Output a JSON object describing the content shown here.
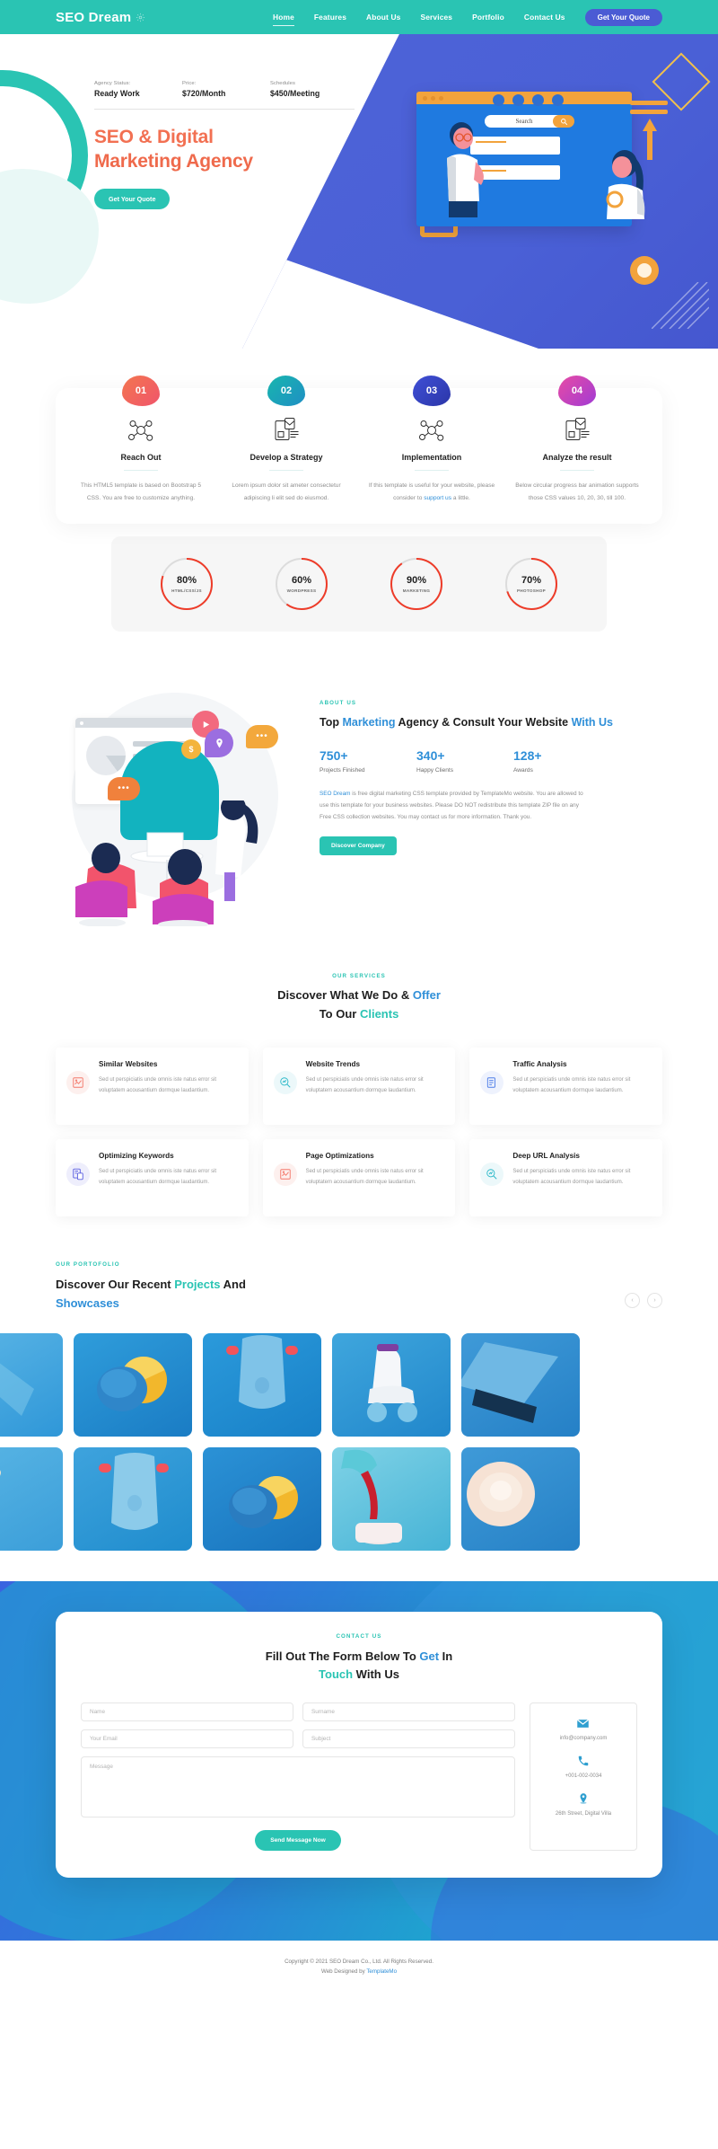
{
  "nav": {
    "brand": "SEO Dream",
    "brand_icon": "gear-settings-icon",
    "links": [
      {
        "label": "Home",
        "active": true
      },
      {
        "label": "Features",
        "active": false
      },
      {
        "label": "About Us",
        "active": false
      },
      {
        "label": "Services",
        "active": false
      },
      {
        "label": "Portfolio",
        "active": false
      },
      {
        "label": "Contact Us",
        "active": false
      }
    ],
    "cta": "Get Your Quote",
    "bg_color": "#2ac4b3",
    "cta_color": "#4b5bd4"
  },
  "hero": {
    "stats": [
      {
        "label": "Agency Status:",
        "value": "Ready Work"
      },
      {
        "label": "Price:",
        "value": "$720/Month"
      },
      {
        "label": "Schedules",
        "value": "$450/Meeting"
      }
    ],
    "title_line1": "SEO & Digital",
    "title_line2": "Marketing Agency",
    "cta": "Get Your Quote",
    "title_color": "#f27052",
    "illustration": {
      "search_placeholder": "Search",
      "name": "seo-team-illustration"
    }
  },
  "process": {
    "items": [
      {
        "number": "01",
        "title": "Reach Out",
        "text": "This HTML5 template is based on Bootstrap 5 CSS. You are free to customize anything.",
        "link_text": "",
        "link_suffix": "",
        "color_a": "#f3764f",
        "color_b": "#f0556b",
        "icon": "network-share-icon"
      },
      {
        "number": "02",
        "title": "Develop a Strategy",
        "text": "Lorem ipsum dolor sit ameter consectetur adipiscing li elit sed do eiusmod.",
        "link_text": "",
        "link_suffix": "",
        "color_a": "#18b6ae",
        "color_b": "#1f8fc4",
        "icon": "document-layout-icon"
      },
      {
        "number": "03",
        "title": "Implementation",
        "text": "If this template is useful for your website, please consider to ",
        "link_text": "support us",
        "link_suffix": " a little.",
        "color_a": "#3f4fd6",
        "color_b": "#2b36a8",
        "icon": "network-share-icon"
      },
      {
        "number": "04",
        "title": "Analyze the result",
        "text": "Below circular progress bar animation supports those CSS values 10, 20, 30, till 100.",
        "link_text": "",
        "link_suffix": "",
        "color_a": "#e84ba4",
        "color_b": "#a13bd4",
        "icon": "document-layout-icon"
      }
    ],
    "skills": [
      {
        "value": "80%",
        "percent": 80,
        "label": "HTML/CSS/JS"
      },
      {
        "value": "60%",
        "percent": 60,
        "label": "WORDPRESS"
      },
      {
        "value": "90%",
        "percent": 90,
        "label": "MARKETING"
      },
      {
        "value": "70%",
        "percent": 70,
        "label": "PHOTOSHOP"
      }
    ],
    "skill_color": "#ee3c29",
    "skill_track_color": "#dcdcdc"
  },
  "about": {
    "eyebrow": "ABOUT US",
    "title_a": "Top ",
    "title_hl1": "Marketing",
    "title_b": " Agency & Consult Your Website ",
    "title_hl2": "With Us",
    "stats": [
      {
        "num": "750+",
        "label": "Projects Finished"
      },
      {
        "num": "340+",
        "label": "Happy Clients"
      },
      {
        "num": "128+",
        "label": "Awards"
      }
    ],
    "para_link": "SEO Dream",
    "para_rest": " is free digital marketing CSS template provided by TemplateMo website. You are allowed to use this template for your business websites. Please DO NOT redistribute this template ZIP file on any Free CSS collection websites. You may contact us for more information. Thank you.",
    "cta": "Discover Company",
    "illustration_name": "team-meeting-illustration"
  },
  "services": {
    "eyebrow": "OUR SERVICES",
    "title_a": "Discover What We Do & ",
    "title_hl1": "Offer",
    "title_b": " To Our ",
    "title_hl2": "Clients",
    "body_text": "Sed ut perspiciatis unde omnis iste natus error sit voluptatem acousantium dormque laudantium.",
    "cards": [
      {
        "title": "Similar Websites",
        "icon": "chart-image-icon",
        "icon_color": "#f4796b",
        "icon_bg": "#fdf0ee"
      },
      {
        "title": "Website Trends",
        "icon": "search-analytics-icon",
        "icon_color": "#2ab8c8",
        "icon_bg": "#ecf8fa"
      },
      {
        "title": "Traffic Analysis",
        "icon": "report-document-icon",
        "icon_color": "#4f7ee8",
        "icon_bg": "#eef2fd"
      },
      {
        "title": "Optimizing Keywords",
        "icon": "keyword-page-icon",
        "icon_color": "#5a5fe0",
        "icon_bg": "#eeeefc"
      },
      {
        "title": "Page Optimizations",
        "icon": "chart-image-icon",
        "icon_color": "#f4796b",
        "icon_bg": "#fdf0ee"
      },
      {
        "title": "Deep URL Analysis",
        "icon": "search-analytics-icon",
        "icon_color": "#2ab8c8",
        "icon_bg": "#ecf8fa"
      }
    ]
  },
  "portfolio": {
    "eyebrow": "OUR PORTOFOLIO",
    "title_a": "Discover Our Recent ",
    "title_hl1": "Projects",
    "title_b": " And ",
    "title_hl2": "Showcases",
    "prev_icon": "chevron-left-icon",
    "next_icon": "chevron-right-icon",
    "row1": [
      {
        "name": "tennis-racket-thumbnail",
        "bg": "#3fa5dd"
      },
      {
        "name": "blue-orange-fruit-thumbnail",
        "bg": "#1f8bd0"
      },
      {
        "name": "blue-skateboard-thumbnail",
        "bg": "#1f93d8"
      },
      {
        "name": "roller-skate-thumbnail",
        "bg": "#2e9ed8"
      },
      {
        "name": "laptop-thumbnail",
        "bg": "#2f8ed5"
      }
    ],
    "row2": [
      {
        "name": "dried-flower-thumbnail",
        "bg": "#46a9e0"
      },
      {
        "name": "blue-skateboard-thumbnail",
        "bg": "#2f9ad9"
      },
      {
        "name": "blue-orange-fruit-thumbnail",
        "bg": "#1f87cf"
      },
      {
        "name": "pouring-drink-thumbnail",
        "bg": "#4bbcd8"
      },
      {
        "name": "white-rose-thumbnail",
        "bg": "#2f8ed5"
      }
    ]
  },
  "contact": {
    "eyebrow": "CONTACT US",
    "title_a": "Fill Out The Form Below To ",
    "title_hl1": "Get",
    "title_b": " In ",
    "title_hl2": "Touch",
    "title_c": " With Us",
    "fields": {
      "name": "Name",
      "surname": "Surname",
      "email": "Your Email",
      "subject": "Subject",
      "message": "Message"
    },
    "submit": "Send Message Now",
    "info": [
      {
        "icon": "envelope-icon",
        "text": "info@company.com"
      },
      {
        "icon": "phone-icon",
        "text": "+001-002-0034"
      },
      {
        "icon": "map-pin-icon",
        "text": "26th Street, Digital Villa"
      }
    ]
  },
  "footer": {
    "copyright": "Copyright © 2021 SEO Dream Co., Ltd. All Rights Reserved.",
    "designed_prefix": "Web Designed by ",
    "designed_by": "TemplateMo"
  }
}
